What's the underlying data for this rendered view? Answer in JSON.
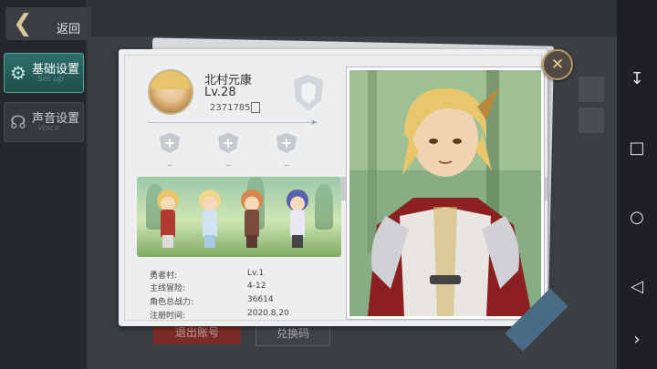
{
  "sidebar": {
    "back_label": "返回",
    "tabs": [
      {
        "label": "基础设置",
        "sub": "Set up",
        "icon": "gear-icon",
        "active": true
      },
      {
        "label": "声音设置",
        "sub": "Voice",
        "icon": "headphones-icon",
        "active": false
      }
    ]
  },
  "background": {
    "logout_label": "退出账号",
    "redeem_label": "兑换码"
  },
  "profile": {
    "name": "北村元康",
    "level": "Lv.28",
    "player_id": "2371785",
    "slots": [
      {
        "label": "--"
      },
      {
        "label": "--"
      },
      {
        "label": "--"
      }
    ],
    "info": [
      {
        "key": "勇者村:",
        "value": "Lv.1"
      },
      {
        "key": "主线冒险:",
        "value": "4-12"
      },
      {
        "key": "角色总战力:",
        "value": "36614"
      },
      {
        "key": "注册时间:",
        "value": "2020.8.20"
      }
    ]
  },
  "colors": {
    "accent_teal": "#2e6f6a",
    "close_gold": "#f0d089",
    "logout_red": "#7a2a27"
  },
  "icons": {
    "back": "chevron-left-icon",
    "close": "close-icon",
    "copy": "copy-icon",
    "nav": [
      "collapse-icon",
      "square-icon",
      "circle-icon",
      "back-triangle-icon",
      "chevron-right-icon"
    ]
  }
}
